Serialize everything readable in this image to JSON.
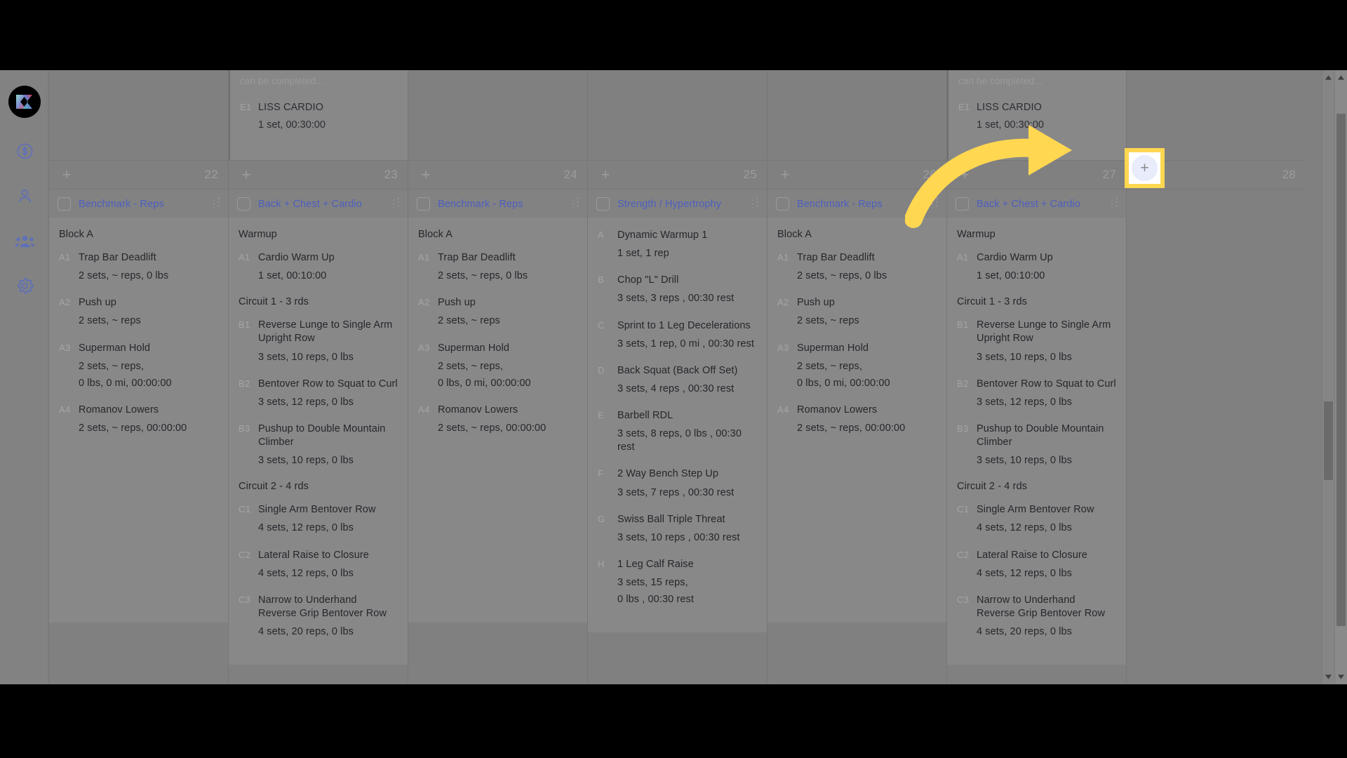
{
  "app": {
    "name": "workout-planner-calendar",
    "accent_blue": "#4d5fc0",
    "highlight_yellow": "#ffd751",
    "board_bg": "#808080"
  },
  "sidebar": {
    "logo_name": "app-logo",
    "items": [
      {
        "icon": "dollar-circle-icon",
        "label": "Billing"
      },
      {
        "icon": "user-icon",
        "label": "Clients"
      },
      {
        "icon": "group-users-icon",
        "label": "Groups"
      },
      {
        "icon": "gear-icon",
        "label": "Settings"
      }
    ]
  },
  "highlight": {
    "plus_glyph": "+",
    "tooltip": "add-workout-highlighted"
  },
  "prev_week": {
    "note": "can be completed...",
    "tag": "E1",
    "name": "LISS CARDIO",
    "sub": "1 set, 00:30:00"
  },
  "scrollbars": {
    "up_glyph": "▲",
    "down_glyph": "▼"
  },
  "columns": [
    {
      "day": "22",
      "add_label": "+",
      "workout": {
        "title": "Benchmark - Reps",
        "blocks": [
          {
            "label": "Block A",
            "exercises": [
              {
                "tag": "A1",
                "name": "Trap Bar Deadlift",
                "sub": "2 sets, ~ reps, 0 lbs"
              },
              {
                "tag": "A2",
                "name": "Push up",
                "sub": "2 sets, ~ reps"
              },
              {
                "tag": "A3",
                "name": "Superman Hold",
                "sub": "2 sets, ~ reps,\n0 lbs, 0 mi, 00:00:00"
              },
              {
                "tag": "A4",
                "name": "Romanov Lowers",
                "sub": "2 sets, ~ reps, 00:00:00"
              }
            ]
          }
        ]
      }
    },
    {
      "day": "23",
      "add_label": "+",
      "workout": {
        "title": "Back + Chest + Cardio",
        "blocks": [
          {
            "label": "Warmup",
            "exercises": [
              {
                "tag": "A1",
                "name": "Cardio Warm Up",
                "sub": "1 set, 00:10:00"
              }
            ]
          },
          {
            "label": "Circuit 1 - 3 rds",
            "exercises": [
              {
                "tag": "B1",
                "name": "Reverse Lunge to Single Arm Upright Row",
                "sub": "3 sets, 10 reps, 0 lbs"
              },
              {
                "tag": "B2",
                "name": "Bentover Row to Squat to Curl",
                "sub": "3 sets, 12 reps, 0 lbs"
              },
              {
                "tag": "B3",
                "name": "Pushup to Double Mountain Climber",
                "sub": "3 sets, 10 reps, 0 lbs"
              }
            ]
          },
          {
            "label": "Circuit 2 - 4 rds",
            "exercises": [
              {
                "tag": "C1",
                "name": "Single Arm Bentover Row",
                "sub": "4 sets, 12 reps, 0 lbs"
              },
              {
                "tag": "C2",
                "name": "Lateral Raise to Closure",
                "sub": "4 sets, 12 reps, 0 lbs"
              },
              {
                "tag": "C3",
                "name": "Narrow to Underhand Reverse Grip Bentover Row",
                "sub": "4 sets, 20 reps, 0 lbs"
              }
            ]
          }
        ]
      }
    },
    {
      "day": "24",
      "add_label": "+",
      "workout": {
        "title": "Benchmark - Reps",
        "blocks": [
          {
            "label": "Block A",
            "exercises": [
              {
                "tag": "A1",
                "name": "Trap Bar Deadlift",
                "sub": "2 sets, ~ reps, 0 lbs"
              },
              {
                "tag": "A2",
                "name": "Push up",
                "sub": "2 sets, ~ reps"
              },
              {
                "tag": "A3",
                "name": "Superman Hold",
                "sub": "2 sets, ~ reps,\n0 lbs, 0 mi, 00:00:00"
              },
              {
                "tag": "A4",
                "name": "Romanov Lowers",
                "sub": "2 sets, ~ reps, 00:00:00"
              }
            ]
          }
        ]
      }
    },
    {
      "day": "25",
      "add_label": "+",
      "workout": {
        "title": "Strength / Hypertrophy",
        "blocks": [
          {
            "label": "",
            "exercises": [
              {
                "tag": "A",
                "name": "Dynamic Warmup 1",
                "sub": "1 set, 1 rep"
              },
              {
                "tag": "B",
                "name": "Chop \"L\" Drill",
                "sub": "3 sets, 3 reps , 00:30 rest"
              },
              {
                "tag": "C",
                "name": "Sprint to 1 Leg Decelerations",
                "sub": "3 sets, 1 rep, 0 mi , 00:30 rest"
              },
              {
                "tag": "D",
                "name": "Back Squat (Back Off Set)",
                "sub": "3 sets, 4 reps , 00:30 rest"
              },
              {
                "tag": "E",
                "name": "Barbell RDL",
                "sub": "3 sets, 8 reps, 0 lbs , 00:30 rest"
              },
              {
                "tag": "F",
                "name": "2 Way Bench Step Up",
                "sub": "3 sets, 7 reps , 00:30 rest"
              },
              {
                "tag": "G",
                "name": "Swiss Ball Triple Threat",
                "sub": "3 sets, 10 reps , 00:30 rest"
              },
              {
                "tag": "H",
                "name": "1 Leg Calf Raise",
                "sub": "3 sets, 15 reps,\n0 lbs , 00:30 rest"
              }
            ]
          }
        ]
      }
    },
    {
      "day": "26",
      "add_label": "+",
      "workout": {
        "title": "Benchmark - Reps",
        "blocks": [
          {
            "label": "Block A",
            "exercises": [
              {
                "tag": "A1",
                "name": "Trap Bar Deadlift",
                "sub": "2 sets, ~ reps, 0 lbs"
              },
              {
                "tag": "A2",
                "name": "Push up",
                "sub": "2 sets, ~ reps"
              },
              {
                "tag": "A3",
                "name": "Superman Hold",
                "sub": "2 sets, ~ reps,\n0 lbs, 0 mi, 00:00:00"
              },
              {
                "tag": "A4",
                "name": "Romanov Lowers",
                "sub": "2 sets, ~ reps, 00:00:00"
              }
            ]
          }
        ]
      }
    },
    {
      "day": "27",
      "add_label": "+",
      "workout": {
        "title": "Back + Chest + Cardio",
        "blocks": [
          {
            "label": "Warmup",
            "exercises": [
              {
                "tag": "A1",
                "name": "Cardio Warm Up",
                "sub": "1 set, 00:10:00"
              }
            ]
          },
          {
            "label": "Circuit 1 - 3 rds",
            "exercises": [
              {
                "tag": "B1",
                "name": "Reverse Lunge to Single Arm Upright Row",
                "sub": "3 sets, 10 reps, 0 lbs"
              },
              {
                "tag": "B2",
                "name": "Bentover Row to Squat to Curl",
                "sub": "3 sets, 12 reps, 0 lbs"
              },
              {
                "tag": "B3",
                "name": "Pushup to Double Mountain Climber",
                "sub": "3 sets, 10 reps, 0 lbs"
              }
            ]
          },
          {
            "label": "Circuit 2 - 4 rds",
            "exercises": [
              {
                "tag": "C1",
                "name": "Single Arm Bentover Row",
                "sub": "4 sets, 12 reps, 0 lbs"
              },
              {
                "tag": "C2",
                "name": "Lateral Raise to Closure",
                "sub": "4 sets, 12 reps, 0 lbs"
              },
              {
                "tag": "C3",
                "name": "Narrow to Underhand Reverse Grip Bentover Row",
                "sub": "4 sets, 20 reps, 0 lbs"
              }
            ]
          }
        ]
      }
    },
    {
      "day": "28",
      "add_label": "+",
      "workout": null
    }
  ]
}
